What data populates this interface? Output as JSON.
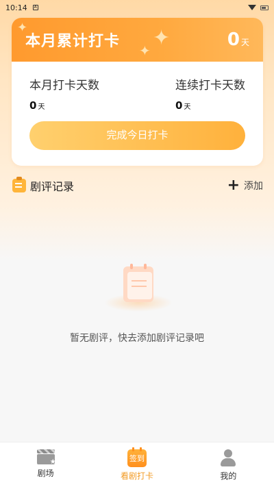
{
  "status_bar": {
    "time": "10:14"
  },
  "card": {
    "title": "本月累计打卡",
    "month_total_value": "0",
    "month_total_unit": "天",
    "stats": [
      {
        "label": "本月打卡天数",
        "value": "0",
        "unit": "天"
      },
      {
        "label": "连续打卡天数",
        "value": "0",
        "unit": "天"
      }
    ],
    "checkin_button": "完成今日打卡"
  },
  "section": {
    "title": "剧评记录",
    "add_label": "添加"
  },
  "empty_state": {
    "text": "暂无剧评，快去添加剧评记录吧"
  },
  "tabbar": {
    "tabs": [
      {
        "label": "剧场",
        "icon": "clapper-icon",
        "active": false
      },
      {
        "label": "看剧打卡",
        "icon": "signin-icon",
        "icon_text": "签到",
        "active": true
      },
      {
        "label": "我的",
        "icon": "profile-icon",
        "active": false
      }
    ]
  },
  "colors": {
    "accent": "#ffa33a",
    "active_tab": "#f29b25"
  }
}
